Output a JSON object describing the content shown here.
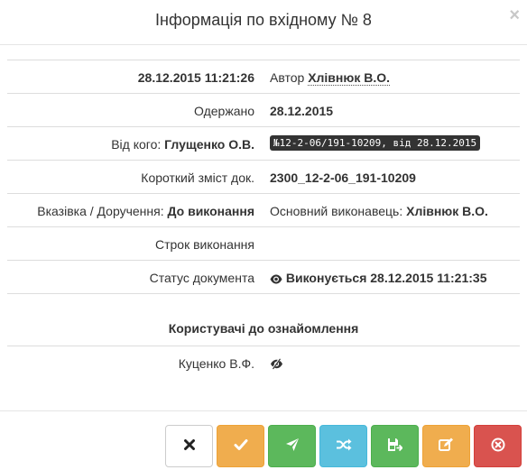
{
  "modal": {
    "title": "Інформація по вхідному № 8",
    "close": "×"
  },
  "rows": {
    "created": {
      "datetime": "28.12.2015 11:21:26",
      "author_label": "Автор",
      "author": "Хлівнюк В.О."
    },
    "received": {
      "label": "Одержано",
      "value": "28.12.2015"
    },
    "from": {
      "label": "Від кого:",
      "value": "Глущенко О.В.",
      "reg_number": "№12-2-06/191-10209, від 28.12.2015"
    },
    "summary": {
      "label": "Короткий зміст док.",
      "value": "2300_12-2-06_191-10209"
    },
    "instruction": {
      "label": "Вказівка / Доручення:",
      "value": "До виконання",
      "executor_label": "Основний виконавець:",
      "executor": "Хлівнюк В.О."
    },
    "deadline": {
      "label": "Строк виконання",
      "value": ""
    },
    "status": {
      "label": "Статус документа",
      "value": "Виконується 28.12.2015 11:21:35",
      "icon": "eye-icon"
    }
  },
  "users_section": {
    "title": "Користувачі до ознайомлення",
    "users": [
      {
        "name": "Куценко В.Ф.",
        "icon": "eye-slash-icon"
      }
    ]
  },
  "buttons": [
    {
      "name": "close-action-button",
      "icon": "times-icon",
      "style": "default"
    },
    {
      "name": "confirm-button",
      "icon": "check-icon",
      "style": "warning"
    },
    {
      "name": "send-button",
      "icon": "send-icon",
      "style": "success"
    },
    {
      "name": "redirect-button",
      "icon": "shuffle-icon",
      "style": "info"
    },
    {
      "name": "save-button",
      "icon": "save-icon",
      "style": "success"
    },
    {
      "name": "edit-button",
      "icon": "edit-icon",
      "style": "warning"
    },
    {
      "name": "cancel-button",
      "icon": "times-circle-icon",
      "style": "danger"
    }
  ],
  "colors": {
    "default": "#ffffff",
    "warning": "#f0ad4e",
    "success": "#5cb85c",
    "info": "#5bc0de",
    "danger": "#d9534f",
    "badge": "#333333"
  }
}
